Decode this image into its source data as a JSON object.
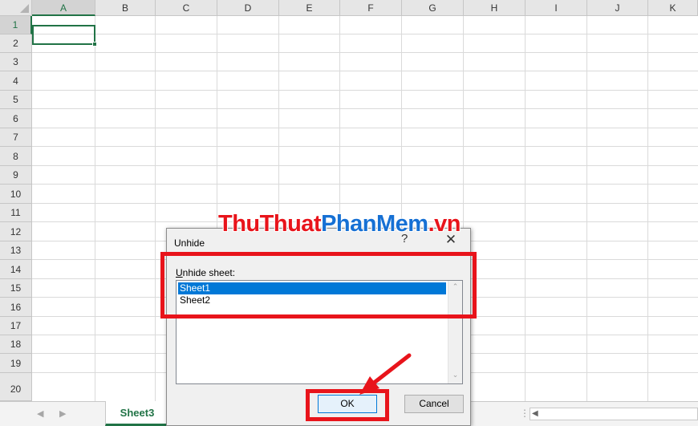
{
  "spreadsheet": {
    "columns": [
      "A",
      "B",
      "C",
      "D",
      "E",
      "F",
      "G",
      "H",
      "I",
      "J",
      "K"
    ],
    "rows": [
      "1",
      "2",
      "3",
      "4",
      "5",
      "6",
      "7",
      "8",
      "9",
      "10",
      "11",
      "12",
      "13",
      "14",
      "15",
      "16",
      "17",
      "18",
      "19",
      "20"
    ],
    "active_cell": "A1",
    "accent_color": "#217346"
  },
  "sheet_tabs": {
    "tabs": [
      "Sheet3"
    ],
    "active": "Sheet3"
  },
  "dialog": {
    "title": "Unhide",
    "help_icon": "?",
    "close_icon": "✕",
    "label_accel": "U",
    "label_rest": "nhide sheet:",
    "items": [
      "Sheet1",
      "Sheet2"
    ],
    "selected_item": "Sheet1",
    "ok_label": "OK",
    "cancel_label": "Cancel"
  },
  "watermark": {
    "part1": "ThuThuat",
    "part2": "PhanMem",
    "part3": ".vn",
    "colors": {
      "red": "#e8141b",
      "blue": "#1670d4"
    }
  },
  "annotations": {
    "highlight_color": "#e8141b",
    "highlights": [
      "sheet-list",
      "ok-button"
    ],
    "arrow_points_to": "ok-button"
  }
}
